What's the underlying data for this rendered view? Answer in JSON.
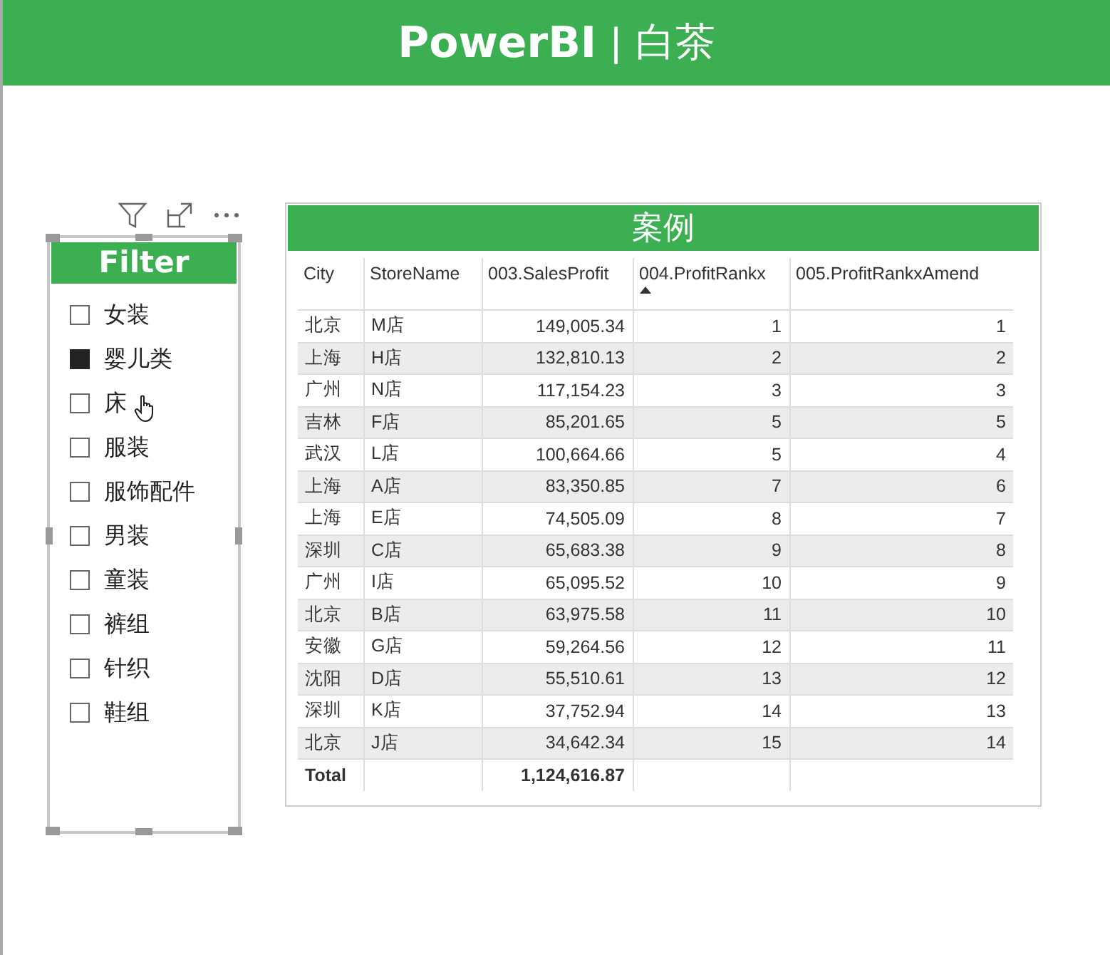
{
  "header": {
    "title_bold": "PowerBI",
    "separator": "|",
    "title_light": "白茶"
  },
  "slicer": {
    "title": "Filter",
    "items": [
      {
        "label": "女装",
        "checked": false
      },
      {
        "label": "婴儿类",
        "checked": true
      },
      {
        "label": "床",
        "checked": false
      },
      {
        "label": "服装",
        "checked": false
      },
      {
        "label": "服饰配件",
        "checked": false
      },
      {
        "label": "男装",
        "checked": false
      },
      {
        "label": "童装",
        "checked": false
      },
      {
        "label": "裤组",
        "checked": false
      },
      {
        "label": "针织",
        "checked": false
      },
      {
        "label": "鞋组",
        "checked": false
      }
    ]
  },
  "table": {
    "title": "案例",
    "columns": [
      {
        "label": "City",
        "sorted": false
      },
      {
        "label": "StoreName",
        "sorted": false
      },
      {
        "label": "003.SalesProfit",
        "sorted": false
      },
      {
        "label": "004.ProfitRankx",
        "sorted": true
      },
      {
        "label": "005.ProfitRankxAmend",
        "sorted": false
      }
    ],
    "rows": [
      [
        "北京",
        "M店",
        "149,005.34",
        "1",
        "1"
      ],
      [
        "上海",
        "H店",
        "132,810.13",
        "2",
        "2"
      ],
      [
        "广州",
        "N店",
        "117,154.23",
        "3",
        "3"
      ],
      [
        "吉林",
        "F店",
        "85,201.65",
        "5",
        "5"
      ],
      [
        "武汉",
        "L店",
        "100,664.66",
        "5",
        "4"
      ],
      [
        "上海",
        "A店",
        "83,350.85",
        "7",
        "6"
      ],
      [
        "上海",
        "E店",
        "74,505.09",
        "8",
        "7"
      ],
      [
        "深圳",
        "C店",
        "65,683.38",
        "9",
        "8"
      ],
      [
        "广州",
        "I店",
        "65,095.52",
        "10",
        "9"
      ],
      [
        "北京",
        "B店",
        "63,975.58",
        "11",
        "10"
      ],
      [
        "安徽",
        "G店",
        "59,264.56",
        "12",
        "11"
      ],
      [
        "沈阳",
        "D店",
        "55,510.61",
        "13",
        "12"
      ],
      [
        "深圳",
        "K店",
        "37,752.94",
        "14",
        "13"
      ],
      [
        "北京",
        "J店",
        "34,642.34",
        "15",
        "14"
      ]
    ],
    "total": {
      "label": "Total",
      "sales_profit": "1,124,616.87"
    }
  }
}
